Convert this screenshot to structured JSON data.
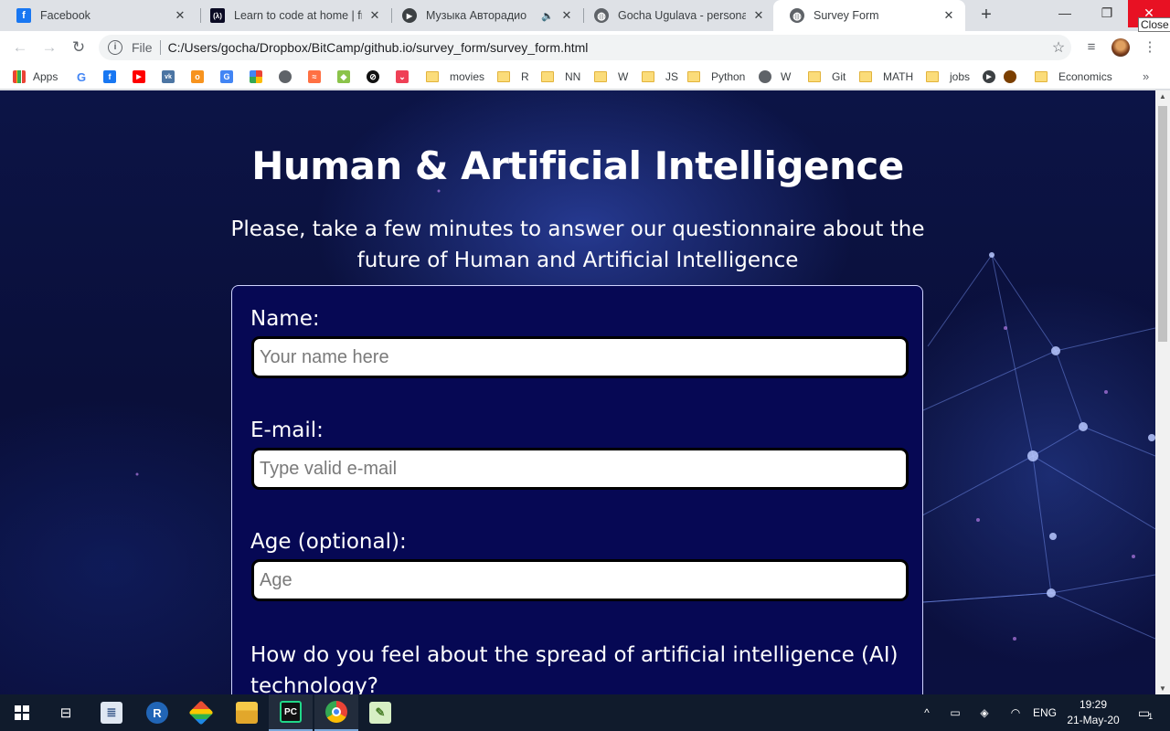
{
  "tabs": [
    {
      "title": "Facebook",
      "icon": "facebook-icon",
      "color": "#1877f2",
      "glyph": "f"
    },
    {
      "title": "Learn to code at home | free",
      "icon": "freecodecamp-icon",
      "color": "#0a0a23",
      "glyph": "(λ)"
    },
    {
      "title": "Музыка Авторадио",
      "icon": "music-icon",
      "color": "#333333",
      "glyph": "▶"
    },
    {
      "title": "Gocha Ugulava - personal p",
      "icon": "globe-icon",
      "color": "#5f6368",
      "glyph": "◍"
    },
    {
      "title": "Survey Form",
      "icon": "globe-icon",
      "color": "#5f6368",
      "glyph": "◍"
    }
  ],
  "window": {
    "close_tooltip": "Close"
  },
  "omnibox": {
    "scheme": "File",
    "url": "C:/Users/gocha/Dropbox/BitCamp/github.io/survey_form/survey_form.html"
  },
  "bookmarks": {
    "apps_label": "Apps",
    "folders": [
      "movies",
      "R",
      "NN",
      "W",
      "JS",
      "Python",
      "W",
      "Git",
      "MATH",
      "jobs",
      "Economics"
    ]
  },
  "page": {
    "title": "Human & Artificial Intelligence",
    "description": "Please, take a few minutes to answer our questionnaire about the future of Human and Artificial Intelligence",
    "form": {
      "name_label": "Name:",
      "name_placeholder": "Your name here",
      "email_label": "E-mail:",
      "email_placeholder": "Type valid e-mail",
      "age_label": "Age (optional):",
      "age_placeholder": "Age",
      "question": "How do you feel about the spread of artificial intelligence (AI) technology?"
    }
  },
  "taskbar": {
    "language": "ENG",
    "time": "19:29",
    "date": "21-May-20",
    "notifications": "1"
  },
  "colors": {
    "page_bg": "#0a0f3a",
    "form_bg": "#060854",
    "close_red": "#e81123"
  }
}
